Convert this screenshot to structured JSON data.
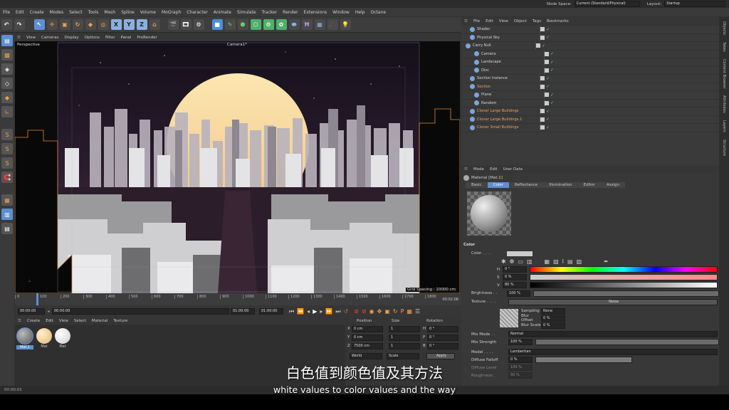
{
  "top": {
    "node_space_label": "Node Space:",
    "node_space_value": "Current (Standard/Physical)",
    "layout_label": "Layout:",
    "layout_value": "Startup"
  },
  "menu": [
    "File",
    "Edit",
    "Create",
    "Modes",
    "Select",
    "Tools",
    "Mesh",
    "Spline",
    "Volume",
    "MoGraph",
    "Character",
    "Animate",
    "Simulate",
    "Tracker",
    "Render",
    "Extensions",
    "Window",
    "Help",
    "Octane"
  ],
  "viewport": {
    "menu": [
      "View",
      "Cameras",
      "Display",
      "Options",
      "Filter",
      "Panel",
      "ProRender"
    ],
    "label": "Perspective",
    "camera_label": "Camera1*",
    "grid_spacing": "Grid Spacing : 10000 cm"
  },
  "timeline": {
    "ticks": [
      "0",
      "100",
      "200",
      "300",
      "400",
      "500",
      "600",
      "700",
      "800",
      "900",
      "1000",
      "1100",
      "1200",
      "1300",
      "1400",
      "1500",
      "1600",
      "1700",
      "1800"
    ],
    "current": "00:00:00",
    "end": "00:02:08"
  },
  "transport": {
    "start": "00:00:00",
    "start2": "00:00:00",
    "end": "01:00:00",
    "end2": "01:00:00"
  },
  "materials": {
    "menu": [
      "Create",
      "Edit",
      "View",
      "Select",
      "Material",
      "Texture"
    ],
    "items": [
      {
        "name": "Mat.1"
      },
      {
        "name": "Mat"
      },
      {
        "name": "Mat"
      }
    ]
  },
  "coords": {
    "headers": [
      "Position",
      "Size",
      "Rotation"
    ],
    "rows": [
      {
        "axis": "X",
        "pos": "0 cm",
        "size": "1",
        "rlabel": "H",
        "rot": "0 °"
      },
      {
        "axis": "Y",
        "pos": "0 cm",
        "size": "1",
        "rlabel": "P",
        "rot": "0 °"
      },
      {
        "axis": "Z",
        "pos": "7500 cm",
        "size": "1",
        "rlabel": "B",
        "rot": "0 °"
      }
    ],
    "world": "World",
    "scale": "Scale",
    "apply": "Apply"
  },
  "objects": {
    "menu": [
      "File",
      "Edit",
      "View",
      "Object",
      "Tags",
      "Bookmarks"
    ],
    "rows": [
      {
        "name": "Shader",
        "indent": 1,
        "color": "#d6d6d6"
      },
      {
        "name": "Physical Sky",
        "indent": 1,
        "color": "#d6d6d6"
      },
      {
        "name": "Carry Null",
        "indent": 0,
        "color": "#d6d6d6"
      },
      {
        "name": "Camera",
        "indent": 2,
        "color": "#d6d6d6"
      },
      {
        "name": "Landscape",
        "indent": 2,
        "color": "#d6d6d6"
      },
      {
        "name": "Disc",
        "indent": 2,
        "color": "#d6d6d6"
      },
      {
        "name": "Section Instance",
        "indent": 1,
        "color": "#d6d6d6"
      },
      {
        "name": "Section",
        "indent": 1,
        "color": "#f0a050"
      },
      {
        "name": "Plane",
        "indent": 2,
        "color": "#d6d6d6"
      },
      {
        "name": "Random",
        "indent": 2,
        "color": "#d6d6d6"
      },
      {
        "name": "Cloner Large Buildings",
        "indent": 1,
        "color": "#f0a050"
      },
      {
        "name": "Cloner Large Buildings.1",
        "indent": 1,
        "color": "#f0a050"
      },
      {
        "name": "Cloner Small Buildings",
        "indent": 1,
        "color": "#f0a050"
      }
    ]
  },
  "attributes": {
    "menu": [
      "Mode",
      "Edit",
      "User Data"
    ],
    "title": "Material [Mat.1]",
    "tabs": [
      "Basic",
      "Color",
      "Reflectance",
      "Illumination",
      "Editor",
      "Assign"
    ],
    "section": "Color",
    "color_label": "Color . . . .",
    "hsv": [
      {
        "k": "H",
        "v": "0 °"
      },
      {
        "k": "S",
        "v": "0 %"
      },
      {
        "k": "V",
        "v": "80 %"
      }
    ],
    "brightness_label": "Brightness . .",
    "brightness_value": "100 %",
    "texture_label": "Texture . . . .",
    "texture_value": "Noise",
    "sampling_label": "Sampling",
    "sampling_value": "None",
    "blur_offset_label": "Blur Offset",
    "blur_offset_value": "0 %",
    "blur_scale_label": "Blur Scale",
    "blur_scale_value": "0 %",
    "mix_mode_label": "Mix Mode . .",
    "mix_mode_value": "Normal",
    "mix_strength_label": "Mix Strength",
    "mix_strength_value": "100 %",
    "model_label": "Model . . . .",
    "model_value": "Lambertian",
    "diffuse_falloff_label": "Diffuse Falloff",
    "diffuse_falloff_value": "0 %",
    "diffuse_level_label": "Diffuse Level",
    "diffuse_level_value": "100 %",
    "roughness_label": "Roughness . .",
    "roughness_value": "50 %"
  },
  "side_tabs": [
    "Objects",
    "Takes",
    "Content Browser",
    "Attributes",
    "Layers",
    "Structure"
  ],
  "status": {
    "time": "00:00:01"
  },
  "subtitle": {
    "zh": "白色值到颜色值及其方法",
    "en": "white values to color values and the way"
  },
  "colors": {
    "accent": "#5d8fd1",
    "orange": "#f0a050",
    "sun": "#f5d48a",
    "sky_top": "#1a1420",
    "sky_bottom": "#5a2a3a"
  }
}
